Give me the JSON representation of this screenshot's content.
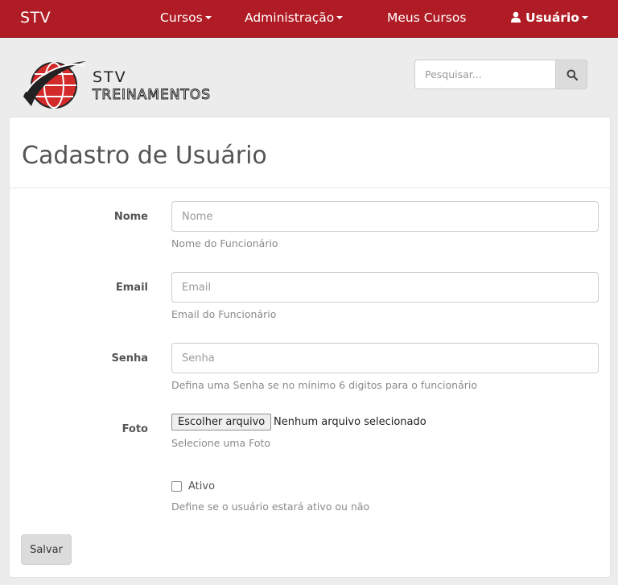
{
  "navbar": {
    "brand": "STV",
    "items": [
      {
        "label": "Cursos",
        "dropdown": true
      },
      {
        "label": "Administração",
        "dropdown": true
      },
      {
        "label": "Meus Cursos",
        "dropdown": false
      },
      {
        "label": "Usuário",
        "dropdown": true,
        "icon": "user-icon"
      }
    ],
    "background": "#b01c25"
  },
  "logo": {
    "line1": "STV",
    "line2": "TREINAMENTOS"
  },
  "search": {
    "placeholder": "Pesquisar...",
    "icon": "search-icon"
  },
  "form": {
    "title": "Cadastro de Usuário",
    "fields": [
      {
        "label": "Nome",
        "placeholder": "Nome",
        "help": "Nome do Funcionário"
      },
      {
        "label": "Email",
        "placeholder": "Email",
        "help": "Email do Funcionário"
      },
      {
        "label": "Senha",
        "placeholder": "Senha",
        "help": "Defina uma Senha se no mínimo 6 digitos para o funcionário"
      }
    ],
    "photo": {
      "label": "Foto",
      "button": "Escolher arquivo",
      "status": "Nenhum arquivo selecionado",
      "help": "Selecione uma Foto"
    },
    "active": {
      "label": "Ativo",
      "checked": false,
      "help": "Define se o usuário estará ativo ou não"
    },
    "submit": "Salvar"
  }
}
